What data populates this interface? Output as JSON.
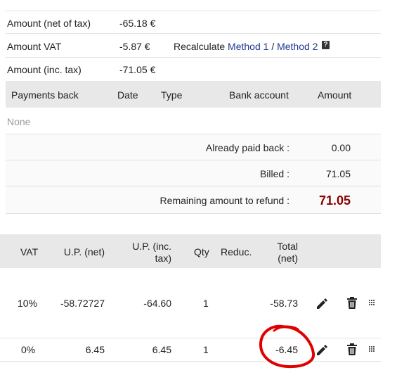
{
  "summary": {
    "rows": [
      {
        "label": "Amount (net of tax)",
        "value": "-65.18 €"
      },
      {
        "label": "Amount VAT",
        "value": "-5.87 €"
      },
      {
        "label": "Amount (inc. tax)",
        "value": "-71.05 €"
      }
    ],
    "recalculate_label": "Recalculate",
    "method1_label": "Method 1",
    "separator": "/",
    "method2_label": "Method 2",
    "help_glyph": "?"
  },
  "payments": {
    "headers": {
      "payments_back": "Payments back",
      "date": "Date",
      "type": "Type",
      "bank_account": "Bank account",
      "amount": "Amount"
    },
    "empty_text": "None",
    "already_paid_label": "Already paid back :",
    "already_paid_value": "0.00",
    "billed_label": "Billed :",
    "billed_value": "71.05",
    "remaining_label": "Remaining amount to refund :",
    "remaining_value": "71.05",
    "remaining_color": "#8b0000"
  },
  "lines": {
    "headers": {
      "vat": "VAT",
      "up_net": "U.P. (net)",
      "up_inc_line1": "U.P. (inc.",
      "up_inc_line2": "tax)",
      "qty": "Qty",
      "reduc": "Reduc.",
      "total_line1": "Total",
      "total_line2": "(net)"
    },
    "rows": [
      {
        "vat": "10%",
        "up_net": "-58.72727",
        "up_inc": "-64.60",
        "qty": "1",
        "total": "-58.73"
      },
      {
        "vat": "0%",
        "up_net": "6.45",
        "up_inc": "6.45",
        "qty": "1",
        "total": "-6.45"
      }
    ],
    "edit_icon": "pencil-icon",
    "delete_icon": "trash-icon",
    "drag_icon": "drag-handle-icon",
    "annotation_color": "#e00000"
  }
}
